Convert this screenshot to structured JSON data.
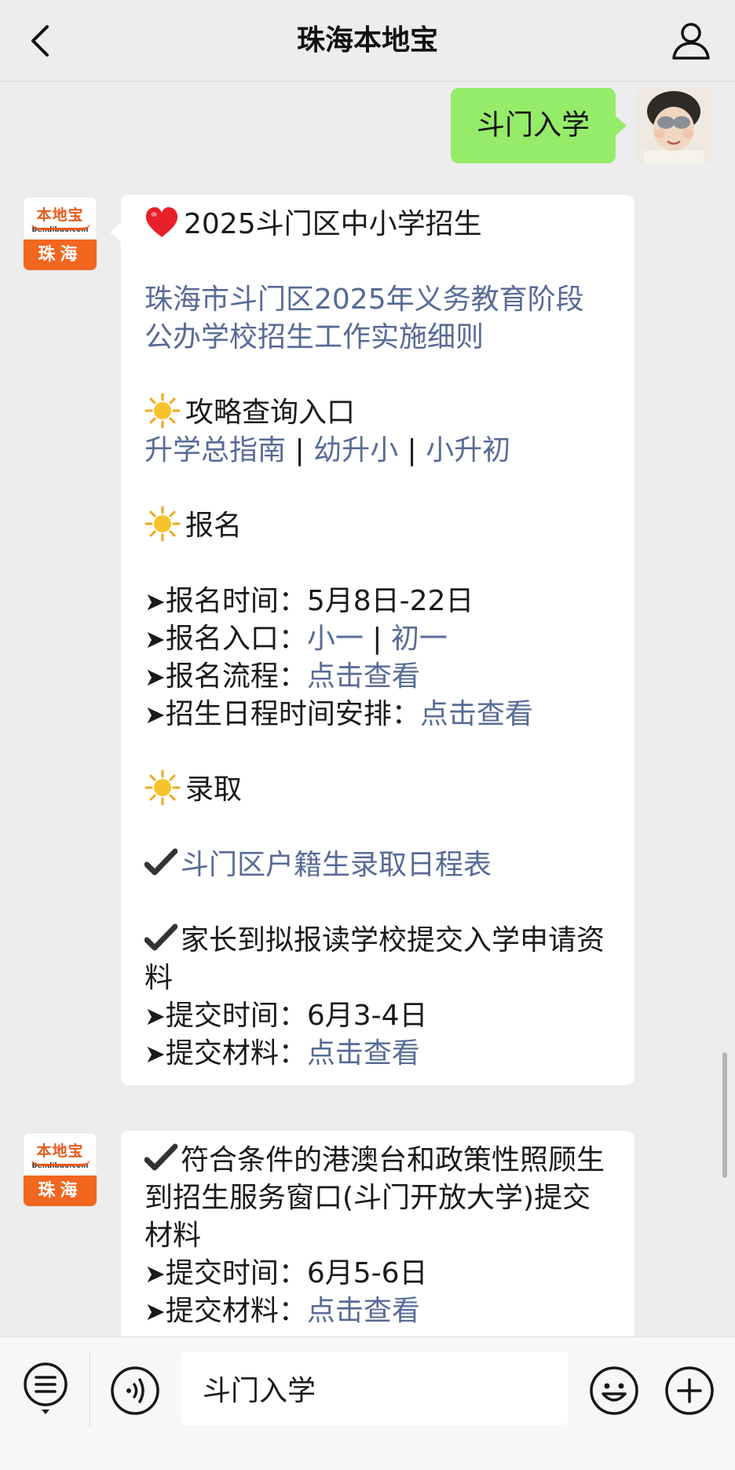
{
  "header": {
    "title": "珠海本地宝",
    "back_icon": "chevron-left-icon",
    "profile_icon": "person-icon"
  },
  "outgoing": {
    "text": "斗门入学"
  },
  "avatar": {
    "brand": "本地宝",
    "url": "Bendibao.com",
    "city": "珠海"
  },
  "message1": {
    "title": "2025斗门区中小学招生",
    "policy_link_line1": "珠海市斗门区2025年义务教育阶段",
    "policy_link_line2": "公办学校招生工作实施细则",
    "guide_heading": "攻略查询入口",
    "guide_links": [
      "升学总指南",
      "幼升小",
      "小升初"
    ],
    "separator": "|",
    "signup_heading": "报名",
    "signup_time_label": "报名时间：",
    "signup_time_value": "5月8日-22日",
    "signup_entry_label": "报名入口：",
    "signup_entry_links": [
      "小一",
      "初一"
    ],
    "signup_process_label": "报名流程：",
    "click_view": "点击查看",
    "schedule_label": "招生日程时间安排：",
    "admission_heading": "录取",
    "household_link": "斗门区户籍生录取日程表",
    "parents_text": "家长到拟报读学校提交入学申请资料",
    "submit_time_label": "提交时间：",
    "submit_time_value": "6月3-4日",
    "submit_material_label": "提交材料："
  },
  "message2": {
    "eligible_text": "符合条件的港澳台和政策性照顾生到招生服务窗口(斗门开放大学)提交材料",
    "submit_time_label": "提交时间：",
    "submit_time_value": "6月5-6日",
    "submit_material_label": "提交材料：",
    "click_view": "点击查看"
  },
  "input_bar": {
    "value": "斗门入学",
    "menu_icon": "list-menu-icon",
    "voice_icon": "voice-icon",
    "emoji_icon": "smiley-icon",
    "plus_icon": "plus-icon"
  },
  "colors": {
    "background": "#ededed",
    "outgoing_bubble": "#95ec69",
    "link": "#576b95",
    "brand_orange": "#f2661f"
  }
}
